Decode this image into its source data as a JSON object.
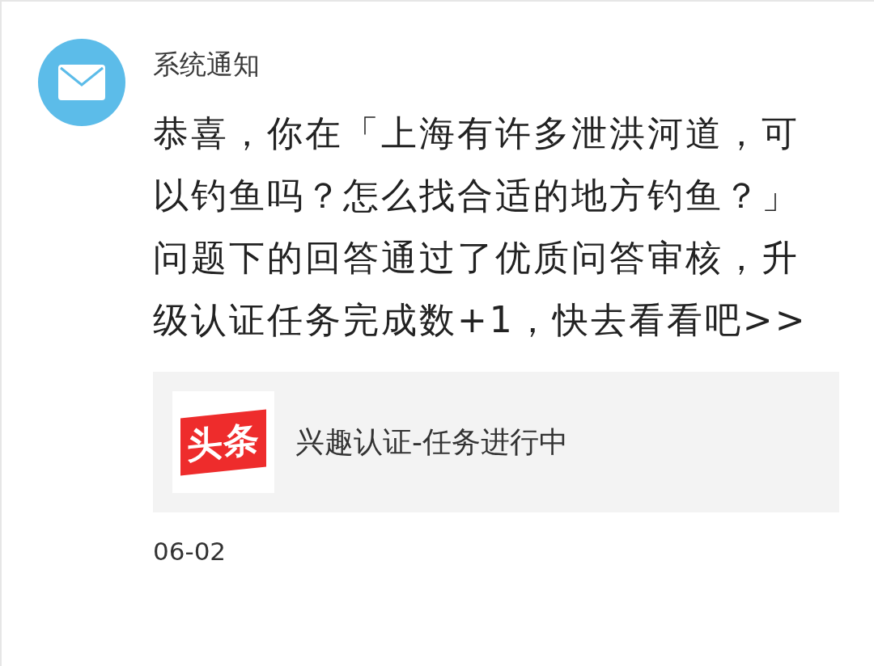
{
  "notification": {
    "sender": "系统通知",
    "message": "恭喜，你在「上海有许多泄洪河道，可以钓鱼吗？怎么找合适的地方钓鱼？」问题下的回答通过了优质问答审核，升级认证任务完成数+1，快去看看吧>>",
    "card": {
      "logo_text": "头条",
      "title": "兴趣认证-任务进行中"
    },
    "date": "06-02"
  }
}
